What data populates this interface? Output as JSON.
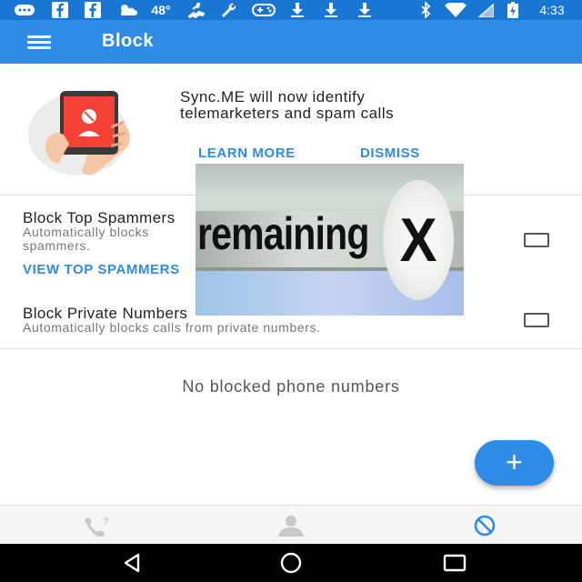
{
  "status_bar": {
    "temperature": "48°",
    "time": "4:33",
    "icons": [
      "messaging-icon",
      "facebook-icon",
      "facebook-icon",
      "weather-icon",
      "run-icon",
      "wrench-icon",
      "gamepad-icon",
      "download-icon",
      "download-icon",
      "download-icon",
      "bluetooth-icon",
      "wifi-icon",
      "signal-icon",
      "battery-icon"
    ]
  },
  "toolbar": {
    "title": "Block",
    "menu_icon": "hamburger-menu-icon"
  },
  "promo": {
    "line1": "Sync.ME will now identify",
    "line2": "telemarketers and spam calls",
    "learn_more": "LEARN MORE",
    "dismiss": "DISMISS"
  },
  "settings": {
    "top_spammers": {
      "title": "Block Top Spammers",
      "desc_line1": "Automatically blocks",
      "desc_line2": "spammers.",
      "link": "VIEW TOP SPAMMERS",
      "checked": false
    },
    "private_numbers": {
      "title": "Block Private Numbers",
      "description": "Automatically blocks calls from private numbers.",
      "checked": false
    }
  },
  "empty_state": "No blocked phone numbers",
  "fab": {
    "label": "+"
  },
  "bottom_tabs": [
    {
      "icon": "unknown-caller-icon",
      "active": false
    },
    {
      "icon": "person-icon",
      "active": false
    },
    {
      "icon": "block-icon",
      "active": true
    }
  ],
  "nav_bar": [
    "back-icon",
    "home-icon",
    "recents-icon"
  ],
  "ad_overlay": {
    "text": "remaining",
    "close": "X"
  },
  "colors": {
    "status_bar": "#1976d2",
    "toolbar": "#2e8be6",
    "accent": "#2e8be6",
    "phone_red": "#f44336"
  }
}
